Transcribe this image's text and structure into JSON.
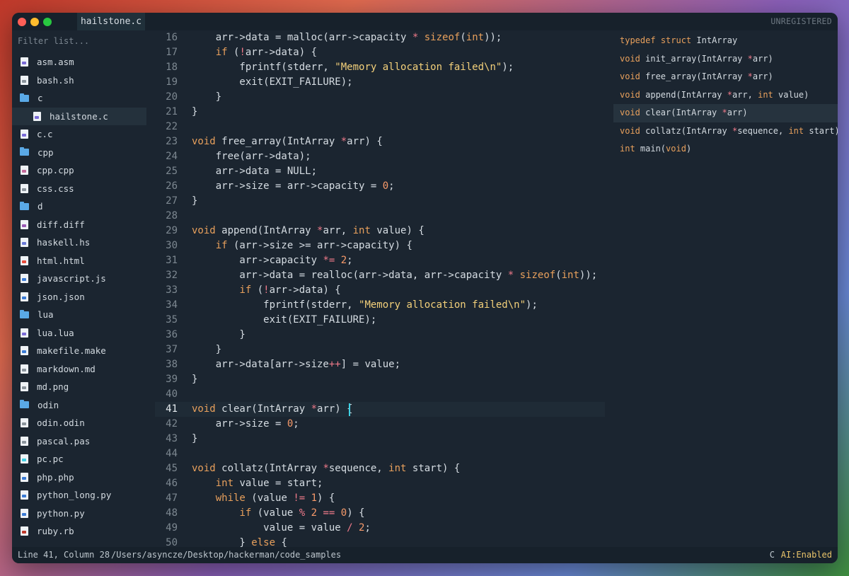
{
  "window": {
    "tab_title": "hailstone.c",
    "unregistered": "UNREGISTERED"
  },
  "sidebar": {
    "filter_placeholder": "Filter list...",
    "items": [
      {
        "label": "asm.asm",
        "type": "file",
        "icon": "asm-file-icon",
        "accent": "#7a6bd8"
      },
      {
        "label": "bash.sh",
        "type": "file",
        "icon": "shell-file-icon",
        "accent": "#8a949c"
      },
      {
        "label": "c",
        "type": "folder",
        "icon": "folder-icon"
      },
      {
        "label": "hailstone.c",
        "type": "file",
        "icon": "c-file-icon",
        "accent": "#7a6bd8",
        "child": true,
        "selected": true
      },
      {
        "label": "c.c",
        "type": "file",
        "icon": "c-file-icon",
        "accent": "#7a6bd8"
      },
      {
        "label": "cpp",
        "type": "folder",
        "icon": "folder-icon"
      },
      {
        "label": "cpp.cpp",
        "type": "file",
        "icon": "cpp-file-icon",
        "accent": "#c46a9a"
      },
      {
        "label": "css.css",
        "type": "file",
        "icon": "css-file-icon",
        "accent": "#8a949c"
      },
      {
        "label": "d",
        "type": "folder",
        "icon": "folder-icon"
      },
      {
        "label": "diff.diff",
        "type": "file",
        "icon": "diff-file-icon",
        "accent": "#9b59b6"
      },
      {
        "label": "haskell.hs",
        "type": "file",
        "icon": "haskell-file-icon",
        "accent": "#6a7ad8"
      },
      {
        "label": "html.html",
        "type": "file",
        "icon": "html-file-icon",
        "accent": "#e74c3c"
      },
      {
        "label": "javascript.js",
        "type": "file",
        "icon": "js-file-icon",
        "accent": "#3a7bd5"
      },
      {
        "label": "json.json",
        "type": "file",
        "icon": "json-file-icon",
        "accent": "#3a7bd5"
      },
      {
        "label": "lua",
        "type": "folder",
        "icon": "folder-icon"
      },
      {
        "label": "lua.lua",
        "type": "file",
        "icon": "lua-file-icon",
        "accent": "#7a6bd8"
      },
      {
        "label": "makefile.make",
        "type": "file",
        "icon": "makefile-file-icon",
        "accent": "#3a7bd5"
      },
      {
        "label": "markdown.md",
        "type": "file",
        "icon": "markdown-file-icon",
        "accent": "#8a949c"
      },
      {
        "label": "md.png",
        "type": "file",
        "icon": "image-file-icon",
        "accent": "#8a949c"
      },
      {
        "label": "odin",
        "type": "folder",
        "icon": "folder-icon"
      },
      {
        "label": "odin.odin",
        "type": "file",
        "icon": "odin-file-icon",
        "accent": "#8a949c"
      },
      {
        "label": "pascal.pas",
        "type": "file",
        "icon": "pascal-file-icon",
        "accent": "#8a949c"
      },
      {
        "label": "pc.pc",
        "type": "file",
        "icon": "pc-file-icon",
        "accent": "#3fd0e3"
      },
      {
        "label": "php.php",
        "type": "file",
        "icon": "php-file-icon",
        "accent": "#3a7bd5"
      },
      {
        "label": "python_long.py",
        "type": "file",
        "icon": "python-file-icon",
        "accent": "#3a7bd5"
      },
      {
        "label": "python.py",
        "type": "file",
        "icon": "python-file-icon",
        "accent": "#3a7bd5"
      },
      {
        "label": "ruby.rb",
        "type": "file",
        "icon": "ruby-file-icon",
        "accent": "#c0392b"
      }
    ]
  },
  "editor": {
    "current_line": 41,
    "lines": [
      {
        "n": "16",
        "html": "    arr-&gt;data = malloc(arr-&gt;capacity <span class='pink'>*</span> <span class='kw'>sizeof</span>(<span class='kw'>int</span>));"
      },
      {
        "n": "17",
        "html": "    <span class='kw'>if</span> (<span class='pink'>!</span>arr-&gt;data) {"
      },
      {
        "n": "18",
        "html": "        fprintf(stderr, <span class='str'>\"Memory allocation failed\\n\"</span>);"
      },
      {
        "n": "19",
        "html": "        exit(EXIT_FAILURE);"
      },
      {
        "n": "20",
        "html": "    }"
      },
      {
        "n": "21",
        "html": "}"
      },
      {
        "n": "22",
        "html": ""
      },
      {
        "n": "23",
        "html": "<span class='kw'>void</span> free_array(IntArray <span class='pink'>*</span>arr) {"
      },
      {
        "n": "24",
        "html": "    free(arr-&gt;data);"
      },
      {
        "n": "25",
        "html": "    arr-&gt;data = NULL;"
      },
      {
        "n": "26",
        "html": "    arr-&gt;size = arr-&gt;capacity = <span class='num'>0</span>;"
      },
      {
        "n": "27",
        "html": "}"
      },
      {
        "n": "28",
        "html": ""
      },
      {
        "n": "29",
        "html": "<span class='kw'>void</span> append(IntArray <span class='pink'>*</span>arr, <span class='kw'>int</span> value) {"
      },
      {
        "n": "30",
        "html": "    <span class='kw'>if</span> (arr-&gt;size &gt;= arr-&gt;capacity) {"
      },
      {
        "n": "31",
        "html": "        arr-&gt;capacity <span class='pink'>*=</span> <span class='num'>2</span>;"
      },
      {
        "n": "32",
        "html": "        arr-&gt;data = realloc(arr-&gt;data, arr-&gt;capacity <span class='pink'>*</span> <span class='kw'>sizeof</span>(<span class='kw'>int</span>));"
      },
      {
        "n": "33",
        "html": "        <span class='kw'>if</span> (<span class='pink'>!</span>arr-&gt;data) {"
      },
      {
        "n": "34",
        "html": "            fprintf(stderr, <span class='str'>\"Memory allocation failed\\n\"</span>);"
      },
      {
        "n": "35",
        "html": "            exit(EXIT_FAILURE);"
      },
      {
        "n": "36",
        "html": "        }"
      },
      {
        "n": "37",
        "html": "    }"
      },
      {
        "n": "38",
        "html": "    arr-&gt;data[arr-&gt;size<span class='pink'>++</span>] = value;"
      },
      {
        "n": "39",
        "html": "}"
      },
      {
        "n": "40",
        "html": ""
      },
      {
        "n": "41",
        "html": "<span class='kw'>void</span> clear(IntArray <span class='pink'>*</span>arr) {"
      },
      {
        "n": "42",
        "html": "    arr-&gt;size = <span class='num'>0</span>;"
      },
      {
        "n": "43",
        "html": "}"
      },
      {
        "n": "44",
        "html": ""
      },
      {
        "n": "45",
        "html": "<span class='kw'>void</span> collatz(IntArray <span class='pink'>*</span>sequence, <span class='kw'>int</span> start) {"
      },
      {
        "n": "46",
        "html": "    <span class='kw'>int</span> value = start;"
      },
      {
        "n": "47",
        "html": "    <span class='kw'>while</span> (value <span class='pink'>!=</span> <span class='num'>1</span>) {"
      },
      {
        "n": "48",
        "html": "        <span class='kw'>if</span> (value <span class='pink'>%</span> <span class='num'>2</span> <span class='pink'>==</span> <span class='num'>0</span>) {"
      },
      {
        "n": "49",
        "html": "            value = value <span class='pink'>/</span> <span class='num'>2</span>;"
      },
      {
        "n": "50",
        "html": "        } <span class='kw'>else</span> {"
      }
    ]
  },
  "symbols": {
    "items": [
      {
        "html": "<span class='kw'>typedef</span> <span class='kw'>struct</span> IntArray"
      },
      {
        "html": "<span class='kw'>void</span> init_array(IntArray <span class='pink'>*</span>arr)"
      },
      {
        "html": "<span class='kw'>void</span> free_array(IntArray <span class='pink'>*</span>arr)"
      },
      {
        "html": "<span class='kw'>void</span> append(IntArray <span class='pink'>*</span>arr, <span class='kw'>int</span> value)"
      },
      {
        "html": "<span class='kw'>void</span> clear(IntArray <span class='pink'>*</span>arr)",
        "selected": true
      },
      {
        "html": "<span class='kw'>void</span> collatz(IntArray <span class='pink'>*</span>sequence, <span class='kw'>int</span> start)"
      },
      {
        "html": "<span class='kw'>int</span> main(<span class='kw'>void</span>)"
      }
    ]
  },
  "statusbar": {
    "position": "Line 41, Column 28",
    "path": "/Users/asyncze/Desktop/hackerman/code_samples",
    "language": "C",
    "ai": "AI:Enabled"
  }
}
